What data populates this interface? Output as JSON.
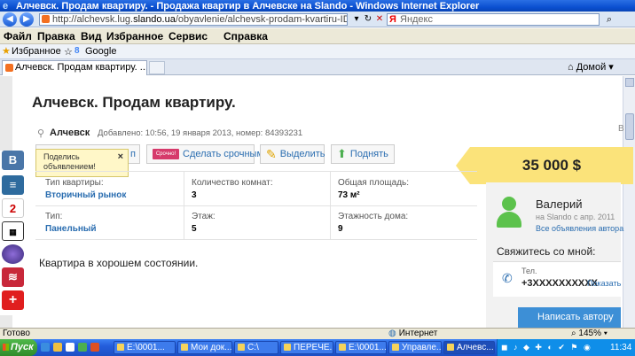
{
  "window": {
    "title": "Алчевск. Продам квартиру. - Продажа квартир в Алчевске на Slando - Windows Internet Explorer"
  },
  "address": {
    "url_prefix": "http://alchevsk.lug.",
    "url_domain": "slando.ua",
    "url_rest": "/obyavlenie/alchevsk-prodam-kvartiru-ID5l",
    "search_placeholder": "Яндекс"
  },
  "menu": [
    "Файл",
    "Правка",
    "Вид",
    "Избранное",
    "Сервис",
    "Справка"
  ],
  "favorites": {
    "label": "Избранное",
    "google": "Google"
  },
  "tab": {
    "label": "Алчевск. Продам квартиру. ...",
    "home": "Домой"
  },
  "ad": {
    "title": "Алчевск. Продам квартиру.",
    "city": "Алчевск",
    "added": "Добавлено: 10:56, 19 января 2013, номер: 84393231",
    "right_edge": "В",
    "actions": {
      "b1_text": "п",
      "urgent_badge": "Срочно!",
      "urgent": "Сделать срочным",
      "highlight": "Выделить",
      "raise": "Поднять"
    },
    "tooltip": "Поделись объявлением!",
    "tooltip_close": "×",
    "price": "35 000 $",
    "fields": [
      {
        "label": "Тип квартиры:",
        "value": "Вторичный рынок",
        "link": true
      },
      {
        "label": "Количество комнат:",
        "value": "3",
        "link": false
      },
      {
        "label": "Общая площадь:",
        "value": "73 м²",
        "link": false
      },
      {
        "label": "Тип:",
        "value": "Панельный",
        "link": true
      },
      {
        "label": "Этаж:",
        "value": "5",
        "link": false
      },
      {
        "label": "Этажность дома:",
        "value": "9",
        "link": false
      }
    ],
    "description": "Квартира в хорошем состоянии."
  },
  "seller": {
    "name": "Валерий",
    "since": "на Slando с апр. 2011",
    "all_ads": "Все объявления автора",
    "contact_header": "Свяжитесь со мной:",
    "tel_label": "Тел.",
    "phone": "+3XXXXXXXXXX",
    "show": "Показать",
    "message_button": "Написать автору"
  },
  "left_icons": [
    "В",
    "2",
    "",
    "",
    "",
    "+"
  ],
  "status": {
    "ready": "Готово",
    "zone": "Интернет",
    "zoom": "145%"
  },
  "taskbar": {
    "start": "Пуск",
    "tasks": [
      "E:\\0001...",
      "Мои док...",
      "C:\\",
      "ПЕРЕЧЕ...",
      "E:\\0001...",
      "Управле...",
      "Алчевс..."
    ],
    "clock": "11:34"
  }
}
